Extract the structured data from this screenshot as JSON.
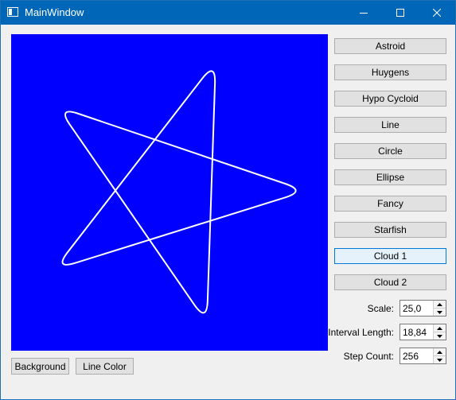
{
  "window": {
    "title": "MainWindow",
    "icons": {
      "app": "app-window-icon",
      "minimize": "minimize-icon",
      "maximize": "maximize-icon",
      "close": "close-icon"
    }
  },
  "canvas": {
    "background_color": "#0000ff",
    "line_color": "#ffffff",
    "shape": "five-pointed star curve (Cloud 1)"
  },
  "curve_buttons": [
    {
      "label": "Astroid"
    },
    {
      "label": "Huygens"
    },
    {
      "label": "Hypo Cycloid"
    },
    {
      "label": "Line"
    },
    {
      "label": "Circle"
    },
    {
      "label": "Ellipse"
    },
    {
      "label": "Fancy"
    },
    {
      "label": "Starfish"
    },
    {
      "label": "Cloud 1",
      "focused": true
    },
    {
      "label": "Cloud 2"
    }
  ],
  "params": {
    "scale": {
      "label": "Scale:",
      "value": "25,0"
    },
    "interval_length": {
      "label": "Interval Length:",
      "value": "18,84"
    },
    "step_count": {
      "label": "Step Count:",
      "value": "256"
    }
  },
  "bottom_buttons": {
    "background": "Background",
    "line_color": "Line Color"
  }
}
